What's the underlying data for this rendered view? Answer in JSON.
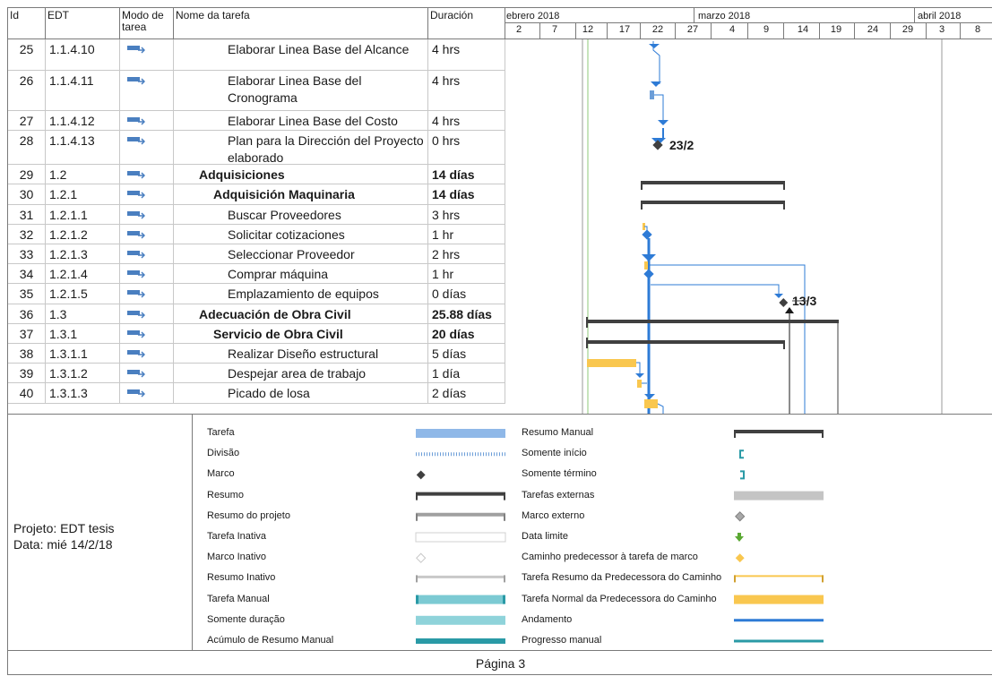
{
  "header": {
    "col_id": "Id",
    "col_edt": "EDT",
    "col_mode": "Modo de tarea",
    "col_name": "Nome da tarefa",
    "col_dur": "Duración",
    "months": [
      "ebrero 2018",
      "marzo 2018",
      "abril 2018"
    ],
    "days": [
      "2",
      "7",
      "12",
      "17",
      "22",
      "27",
      "4",
      "9",
      "14",
      "19",
      "24",
      "29",
      "3",
      "8"
    ]
  },
  "tasks": [
    {
      "id": "25",
      "edt": "1.1.4.10",
      "name": "Elaborar Linea Base del Alcance",
      "dur": "4 hrs",
      "bold": false,
      "indent": 3
    },
    {
      "id": "26",
      "edt": "1.1.4.11",
      "name": "Elaborar Linea Base del Cronograma",
      "dur": "4 hrs",
      "bold": false,
      "indent": 3
    },
    {
      "id": "27",
      "edt": "1.1.4.12",
      "name": "Elaborar Linea Base del Costo",
      "dur": "4 hrs",
      "bold": false,
      "indent": 3
    },
    {
      "id": "28",
      "edt": "1.1.4.13",
      "name": "Plan para la Dirección del Proyecto elaborado",
      "dur": "0 hrs",
      "bold": false,
      "indent": 3
    },
    {
      "id": "29",
      "edt": "1.2",
      "name": "Adquisiciones",
      "dur": "14 días",
      "bold": true,
      "indent": 1
    },
    {
      "id": "30",
      "edt": "1.2.1",
      "name": "Adquisición Maquinaria",
      "dur": "14 días",
      "bold": true,
      "indent": 2
    },
    {
      "id": "31",
      "edt": "1.2.1.1",
      "name": "Buscar Proveedores",
      "dur": "3 hrs",
      "bold": false,
      "indent": 3
    },
    {
      "id": "32",
      "edt": "1.2.1.2",
      "name": "Solicitar cotizaciones",
      "dur": "1 hr",
      "bold": false,
      "indent": 3
    },
    {
      "id": "33",
      "edt": "1.2.1.3",
      "name": "Seleccionar Proveedor",
      "dur": "2 hrs",
      "bold": false,
      "indent": 3
    },
    {
      "id": "34",
      "edt": "1.2.1.4",
      "name": "Comprar máquina",
      "dur": "1 hr",
      "bold": false,
      "indent": 3
    },
    {
      "id": "35",
      "edt": "1.2.1.5",
      "name": "Emplazamiento de equipos",
      "dur": "0 días",
      "bold": false,
      "indent": 3
    },
    {
      "id": "36",
      "edt": "1.3",
      "name": "Adecuación de Obra Civil",
      "dur": "25.88 días",
      "bold": true,
      "indent": 1
    },
    {
      "id": "37",
      "edt": "1.3.1",
      "name": "Servicio de Obra Civil",
      "dur": "20 días",
      "bold": true,
      "indent": 2
    },
    {
      "id": "38",
      "edt": "1.3.1.1",
      "name": "Realizar Diseño estructural",
      "dur": "5 días",
      "bold": false,
      "indent": 3
    },
    {
      "id": "39",
      "edt": "1.3.1.2",
      "name": "Despejar area de trabajo",
      "dur": "1 día",
      "bold": false,
      "indent": 3
    },
    {
      "id": "40",
      "edt": "1.3.1.3",
      "name": "Picado de losa",
      "dur": "2 días",
      "bold": false,
      "indent": 3
    }
  ],
  "milestone_labels": {
    "m28": "23/2",
    "m35": "13/3"
  },
  "legend": {
    "project": "Projeto: EDT tesis",
    "date": "Data: mié 14/2/18",
    "left_items": [
      "Tarefa",
      "Divisão",
      "Marco",
      "Resumo",
      "Resumo do projeto",
      "Tarefa Inativa",
      "Marco Inativo",
      "Resumo Inativo",
      "Tarefa Manual",
      "Somente duração",
      "Acúmulo de Resumo Manual"
    ],
    "right_items": [
      "Resumo Manual",
      "Somente início",
      "Somente término",
      "Tarefas externas",
      "Marco externo",
      "Data limite",
      "Caminho predecessor à tarefa de marco",
      "Tarefa Resumo da Predecessora do Caminho",
      "Tarefa Normal da Predecessora do Caminho",
      "Andamento",
      "Progresso manual"
    ]
  },
  "colors": {
    "task_blue": "#2e7bd6",
    "manual_blue": "#6c9ed8",
    "summary": "#404040",
    "critical_yellow": "#f9c74f",
    "teal": "#2a9aa6",
    "green": "#5aa832"
  },
  "footer": "Página 3"
}
